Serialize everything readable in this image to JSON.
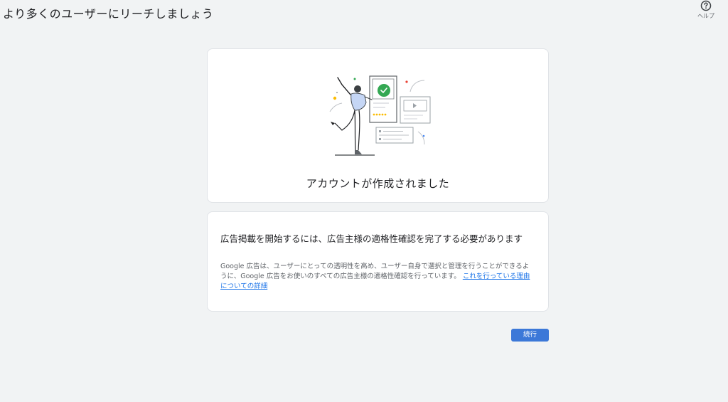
{
  "header": {
    "title": "より多くのユーザーにリーチしましょう",
    "help_label": "ヘルプ",
    "help_icon": "help-circle-icon"
  },
  "success_card": {
    "title": "アカウントが作成されました",
    "illustration": "person-celebrating-ad-cards-illustration"
  },
  "requirement_card": {
    "title": "広告掲載を開始するには、広告主様の適格性確認を完了する必要があります",
    "body": "Google 広告は、ユーザーにとっての透明性を高め、ユーザー自身で選択と管理を行うことができるように、Google 広告をお使いのすべての広告主様の適格性確認を行っています。",
    "link_text": "これを行っている理由についての詳細"
  },
  "actions": {
    "continue_label": "続行"
  },
  "colors": {
    "background": "#f1f3f4",
    "primary": "#3c78d8",
    "link": "#1a73e8",
    "success": "#34a853"
  }
}
